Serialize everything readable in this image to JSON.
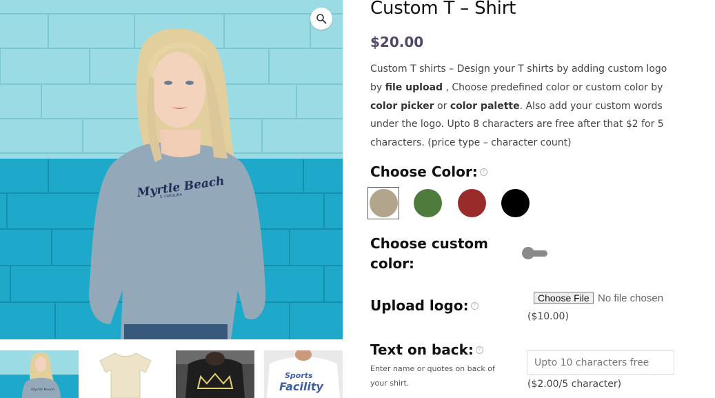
{
  "product": {
    "title": "Custom T – Shirt",
    "price": "$20.00",
    "description": {
      "p1": "Custom T shirts – Design your T shirts by adding custom logo by ",
      "b1": "file upload",
      "p2": " , Choose predefined color or custom color by ",
      "b2": "color picker",
      "p3": " or ",
      "b3": "color palette",
      "p4": ". Also add your custom words under the logo. Upto 8 characters are free after that $2 for 5 characters. (price type – character count)"
    }
  },
  "gallery": {
    "main_alt": "Woman in grey Myrtle Beach sweatshirt",
    "sweatshirt_text": "Myrtle Beach",
    "sweatshirt_subtext": "S. CAROLINA",
    "zoom_icon": "magnifier-icon",
    "thumbnails": [
      {
        "name": "thumb-sweatshirt-woman"
      },
      {
        "name": "thumb-cream-tshirt"
      },
      {
        "name": "thumb-black-crown-tshirt"
      },
      {
        "name": "thumb-white-sports-tshirt",
        "text": "Sports Facility"
      }
    ]
  },
  "fields": {
    "color": {
      "label": "Choose Color:",
      "help": "?",
      "swatches": [
        {
          "name": "beige",
          "hex": "#b3a58c",
          "selected": true
        },
        {
          "name": "green",
          "hex": "#4f7b3c",
          "selected": false
        },
        {
          "name": "red",
          "hex": "#992b2b",
          "selected": false
        },
        {
          "name": "black",
          "hex": "#000000",
          "selected": false
        }
      ]
    },
    "custom_color": {
      "label_line1": "Choose custom",
      "label_line2": "color:",
      "enabled": false
    },
    "logo": {
      "label": "Upload logo:",
      "help": "?",
      "button": "Choose File",
      "status": "No file chosen",
      "price": "($10.00)"
    },
    "back_text": {
      "label": "Text on back:",
      "help": "?",
      "hint": "Enter name or quotes on back of your shirt.",
      "placeholder": "Upto 10 characters free",
      "value": "",
      "price": "($2.00/5 character)"
    }
  }
}
